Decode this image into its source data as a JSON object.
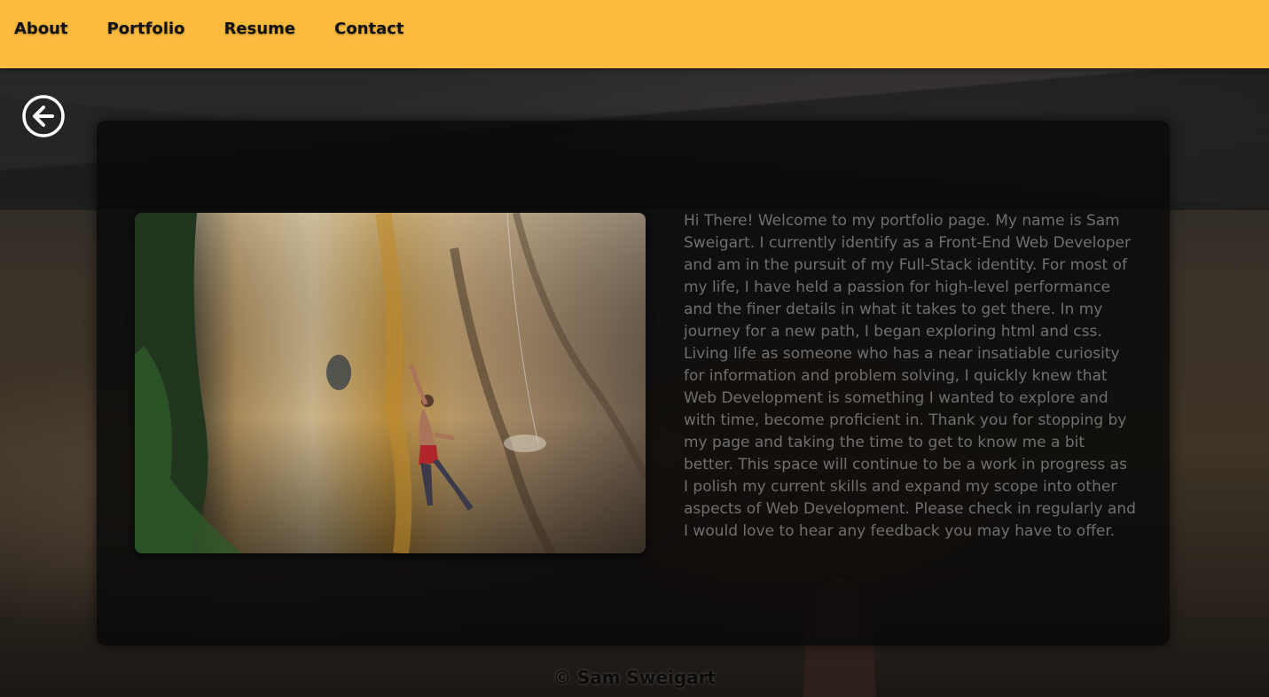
{
  "nav": {
    "items": [
      {
        "label": "About"
      },
      {
        "label": "Portfolio"
      },
      {
        "label": "Resume"
      },
      {
        "label": "Contact"
      }
    ]
  },
  "back_button": {
    "icon": "arrow-left-circle-icon"
  },
  "about": {
    "image_description": "rock climber on orange and gray cliff face",
    "bio": "Hi There! Welcome to my portfolio page. My name is Sam Sweigart. I currently identify as a Front-End Web Developer and am in the pursuit of my Full-Stack identity. For most of my life, I have held a passion for high-level performance and the finer details in what it takes to get there. In my journey for a new path, I began exploring html and css. Living life as someone who has a near insatiable curiosity for information and problem solving, I quickly knew that Web Development is something I wanted to explore and with time, become proficient in. Thank you for stopping by my page and taking the time to get to know me a bit better. This space will continue to be a work in progress as I polish my current skills and expand my scope into other aspects of Web Development. Please check in regularly and I would love to hear any feedback you may have to offer."
  },
  "footer": {
    "text": "© Sam Sweigart"
  },
  "colors": {
    "navbar": "#fbbb3e",
    "card": "#080808",
    "bio_text": "#6f6f6f"
  }
}
